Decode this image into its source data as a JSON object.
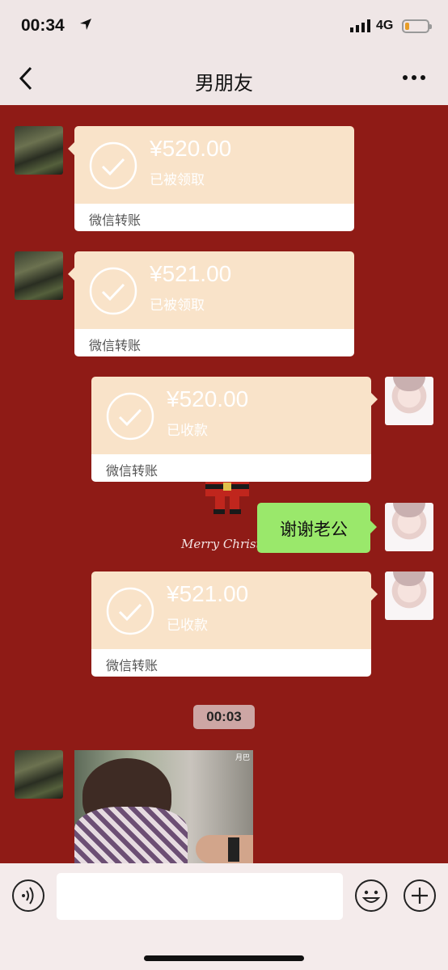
{
  "status_bar": {
    "time": "00:34",
    "network": "4G",
    "location_icon": "location-arrow-icon",
    "signal_icon": "signal-bars-icon",
    "battery_icon": "battery-low-icon",
    "battery_color": "#e79d27"
  },
  "header": {
    "title": "男朋友",
    "back_icon": "chevron-left-icon",
    "more_icon": "more-dots-icon"
  },
  "messages": [
    {
      "side": "left",
      "type": "transfer",
      "amount": "¥520.00",
      "status": "已被领取",
      "label": "微信转账"
    },
    {
      "side": "left",
      "type": "transfer",
      "amount": "¥521.00",
      "status": "已被领取",
      "label": "微信转账"
    },
    {
      "side": "right",
      "type": "transfer",
      "amount": "¥520.00",
      "status": "已收款",
      "label": "微信转账"
    },
    {
      "side": "right",
      "type": "text",
      "text": "谢谢老公"
    },
    {
      "side": "right",
      "type": "transfer",
      "amount": "¥521.00",
      "status": "已收款",
      "label": "微信转账"
    },
    {
      "type": "timestamp",
      "text": "00:03"
    },
    {
      "side": "left",
      "type": "image",
      "watermark": "月巴"
    }
  ],
  "background": {
    "greeting": "Merry Christm",
    "color": "#8f1b16"
  },
  "colors": {
    "transfer_card": "#f9e3c9",
    "text_bubble": "#9ae86b"
  },
  "input_bar": {
    "placeholder": "",
    "voice_icon": "voice-icon",
    "emoji_icon": "emoji-smile-icon",
    "add_icon": "plus-circle-icon"
  }
}
